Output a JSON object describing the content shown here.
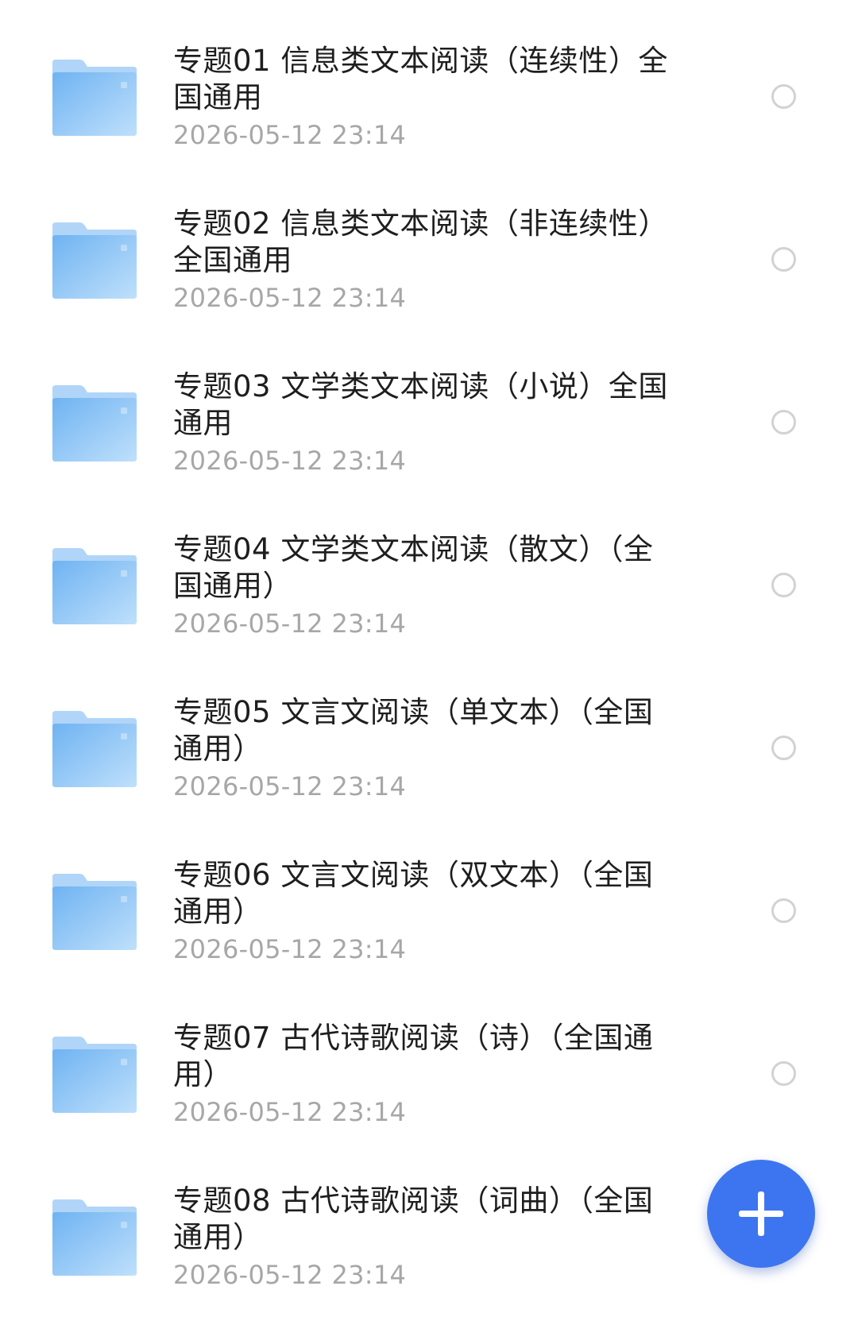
{
  "files": [
    {
      "name": "专题01 信息类文本阅读（连续性）全国通用",
      "date": "2026-05-12 23:14",
      "icon": "folder-icon"
    },
    {
      "name": "专题02 信息类文本阅读（非连续性）全国通用",
      "date": "2026-05-12 23:14",
      "icon": "folder-icon"
    },
    {
      "name": "专题03 文学类文本阅读（小说）全国通用",
      "date": "2026-05-12 23:14",
      "icon": "folder-icon"
    },
    {
      "name": "专题04 文学类文本阅读（散文）（全国通用）",
      "date": "2026-05-12 23:14",
      "icon": "folder-icon"
    },
    {
      "name": "专题05 文言文阅读（单文本）（全国通用）",
      "date": "2026-05-12 23:14",
      "icon": "folder-icon"
    },
    {
      "name": "专题06 文言文阅读（双文本）（全国通用）",
      "date": "2026-05-12 23:14",
      "icon": "folder-icon"
    },
    {
      "name": "专题07 古代诗歌阅读（诗）（全国通用）",
      "date": "2026-05-12 23:14",
      "icon": "folder-icon"
    },
    {
      "name": "专题08 古代诗歌阅读（词曲）（全国通用）",
      "date": "2026-05-12 23:14",
      "icon": "folder-icon"
    }
  ],
  "fab": {
    "icon": "plus-icon"
  },
  "colors": {
    "folder_light": "#bfe0fb",
    "folder_dark": "#6fb3f2",
    "accent": "#3d75f0",
    "date_text": "#a7a7a7",
    "radio_border": "#d2d2d2"
  }
}
